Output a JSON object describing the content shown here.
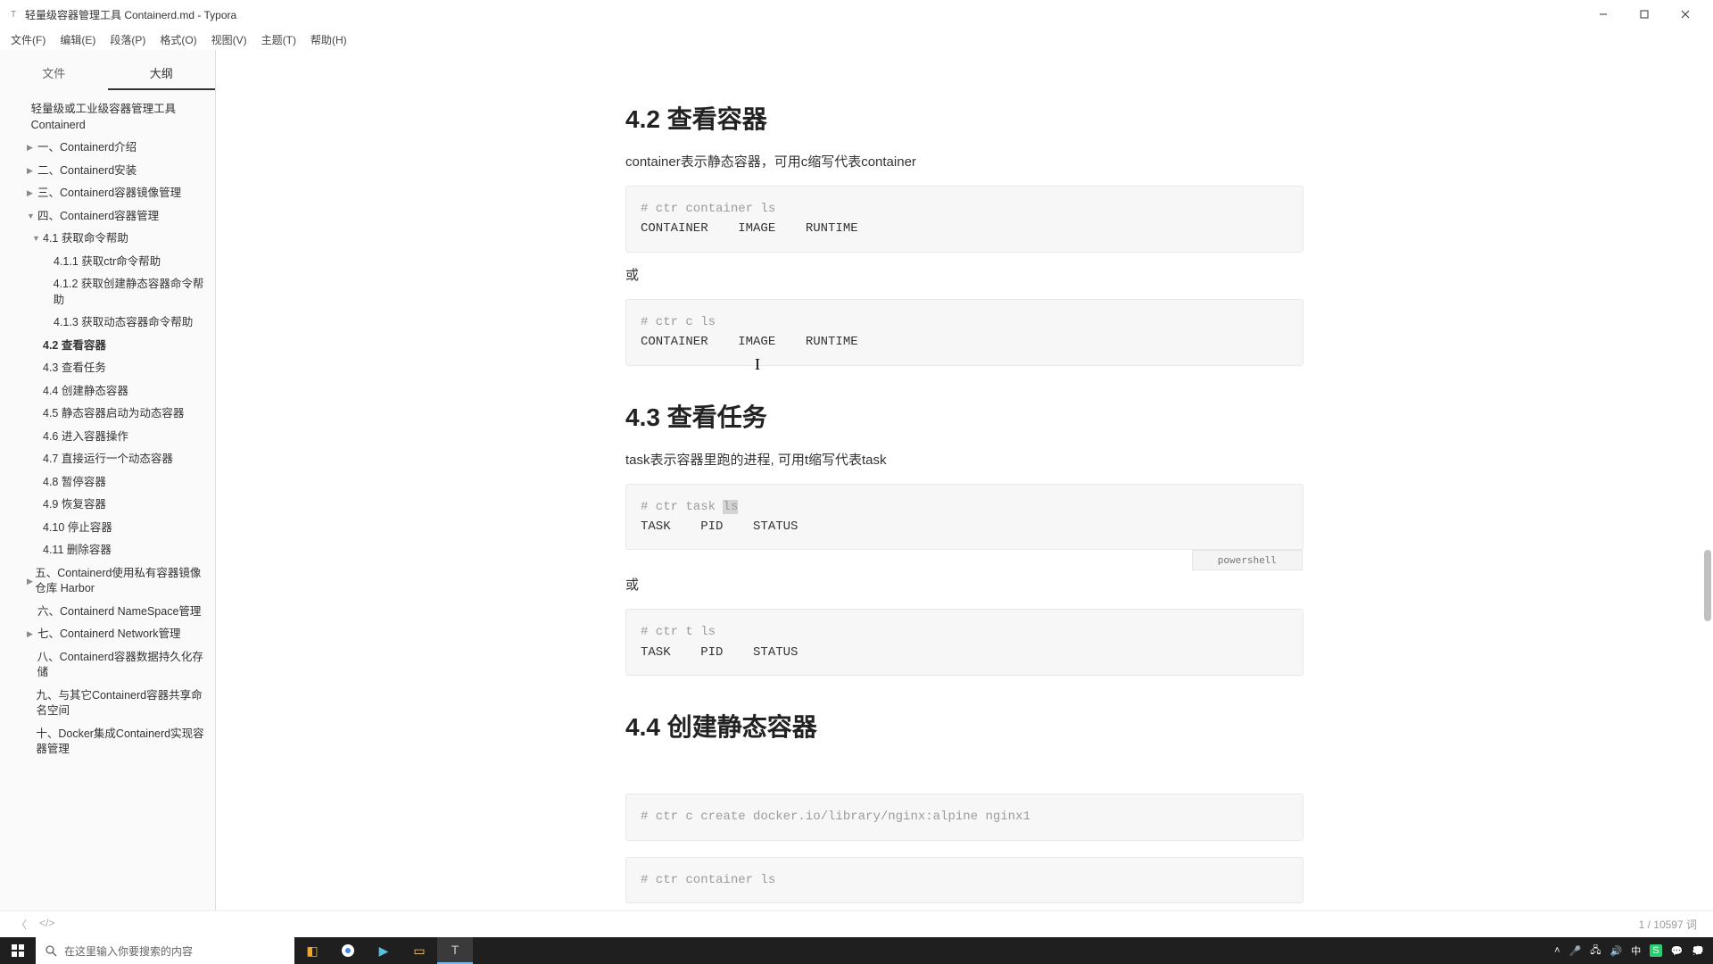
{
  "window": {
    "title": "轻量级容器管理工具 Containerd.md - Typora"
  },
  "menu": [
    "文件(F)",
    "编辑(E)",
    "段落(P)",
    "格式(O)",
    "视图(V)",
    "主题(T)",
    "帮助(H)"
  ],
  "sidebar": {
    "tabs": {
      "files": "文件",
      "outline": "大纲"
    },
    "doc_title": "轻量级或工业级容器管理工具 Containerd",
    "items": [
      {
        "label": "一、Containerd介绍",
        "lvl": 2,
        "caret": "▶",
        "bold": false
      },
      {
        "label": "二、Containerd安装",
        "lvl": 2,
        "caret": "▶",
        "bold": false
      },
      {
        "label": "三、Containerd容器镜像管理",
        "lvl": 2,
        "caret": "▶",
        "bold": false
      },
      {
        "label": "四、Containerd容器管理",
        "lvl": 2,
        "caret": "▼",
        "bold": false
      },
      {
        "label": "4.1 获取命令帮助",
        "lvl": 3,
        "caret": "▼",
        "bold": false
      },
      {
        "label": "4.1.1 获取ctr命令帮助",
        "lvl": 4,
        "caret": "",
        "bold": false
      },
      {
        "label": "4.1.2 获取创建静态容器命令帮助",
        "lvl": 4,
        "caret": "",
        "bold": false
      },
      {
        "label": "4.1.3 获取动态容器命令帮助",
        "lvl": 4,
        "caret": "",
        "bold": false
      },
      {
        "label": "4.2 查看容器",
        "lvl": 3,
        "caret": "",
        "bold": true
      },
      {
        "label": "4.3 查看任务",
        "lvl": 3,
        "caret": "",
        "bold": false
      },
      {
        "label": "4.4 创建静态容器",
        "lvl": 3,
        "caret": "",
        "bold": false
      },
      {
        "label": "4.5 静态容器启动为动态容器",
        "lvl": 3,
        "caret": "",
        "bold": false
      },
      {
        "label": "4.6 进入容器操作",
        "lvl": 3,
        "caret": "",
        "bold": false
      },
      {
        "label": "4.7 直接运行一个动态容器",
        "lvl": 3,
        "caret": "",
        "bold": false
      },
      {
        "label": "4.8 暂停容器",
        "lvl": 3,
        "caret": "",
        "bold": false
      },
      {
        "label": "4.9 恢复容器",
        "lvl": 3,
        "caret": "",
        "bold": false
      },
      {
        "label": "4.10 停止容器",
        "lvl": 3,
        "caret": "",
        "bold": false
      },
      {
        "label": "4.11 删除容器",
        "lvl": 3,
        "caret": "",
        "bold": false
      },
      {
        "label": "五、Containerd使用私有容器镜像仓库 Harbor",
        "lvl": 2,
        "caret": "▶",
        "bold": false
      },
      {
        "label": "六、Containerd NameSpace管理",
        "lvl": 2,
        "caret": "",
        "bold": false
      },
      {
        "label": "七、Containerd Network管理",
        "lvl": 2,
        "caret": "▶",
        "bold": false
      },
      {
        "label": "八、Containerd容器数据持久化存储",
        "lvl": 2,
        "caret": "",
        "bold": false
      },
      {
        "label": "九、与其它Containerd容器共享命名空间",
        "lvl": 2,
        "caret": "",
        "bold": false
      },
      {
        "label": "十、Docker集成Containerd实现容器管理",
        "lvl": 2,
        "caret": "",
        "bold": false
      }
    ]
  },
  "content": {
    "h42": "4.2 查看容器",
    "p42": "container表示静态容器，可用c缩写代表container",
    "code42a_c": "# ctr container ls",
    "code42a_b": "CONTAINER    IMAGE    RUNTIME",
    "or1": "或",
    "code42b_c": "# ctr c ls",
    "code42b_b": "CONTAINER    IMAGE    RUNTIME",
    "h43": "4.3 查看任务",
    "p43": "task表示容器里跑的进程, 可用t缩写代表task",
    "code43a_c": "# ctr task ",
    "code43a_hl": "ls",
    "code43a_b": "TASK    PID    STATUS",
    "lang43": "powershell",
    "or2": "或",
    "code43b_c": "# ctr t ls",
    "code43b_b": "TASK    PID    STATUS",
    "h44": "4.4 创建静态容器",
    "code44a": "# ctr c create docker.io/library/nginx:alpine nginx1",
    "code44b": "# ctr container ls"
  },
  "statusbar": {
    "words": "1 / 10597 词"
  },
  "taskbar": {
    "search_placeholder": "在这里输入你要搜索的内容",
    "ime": "中"
  }
}
